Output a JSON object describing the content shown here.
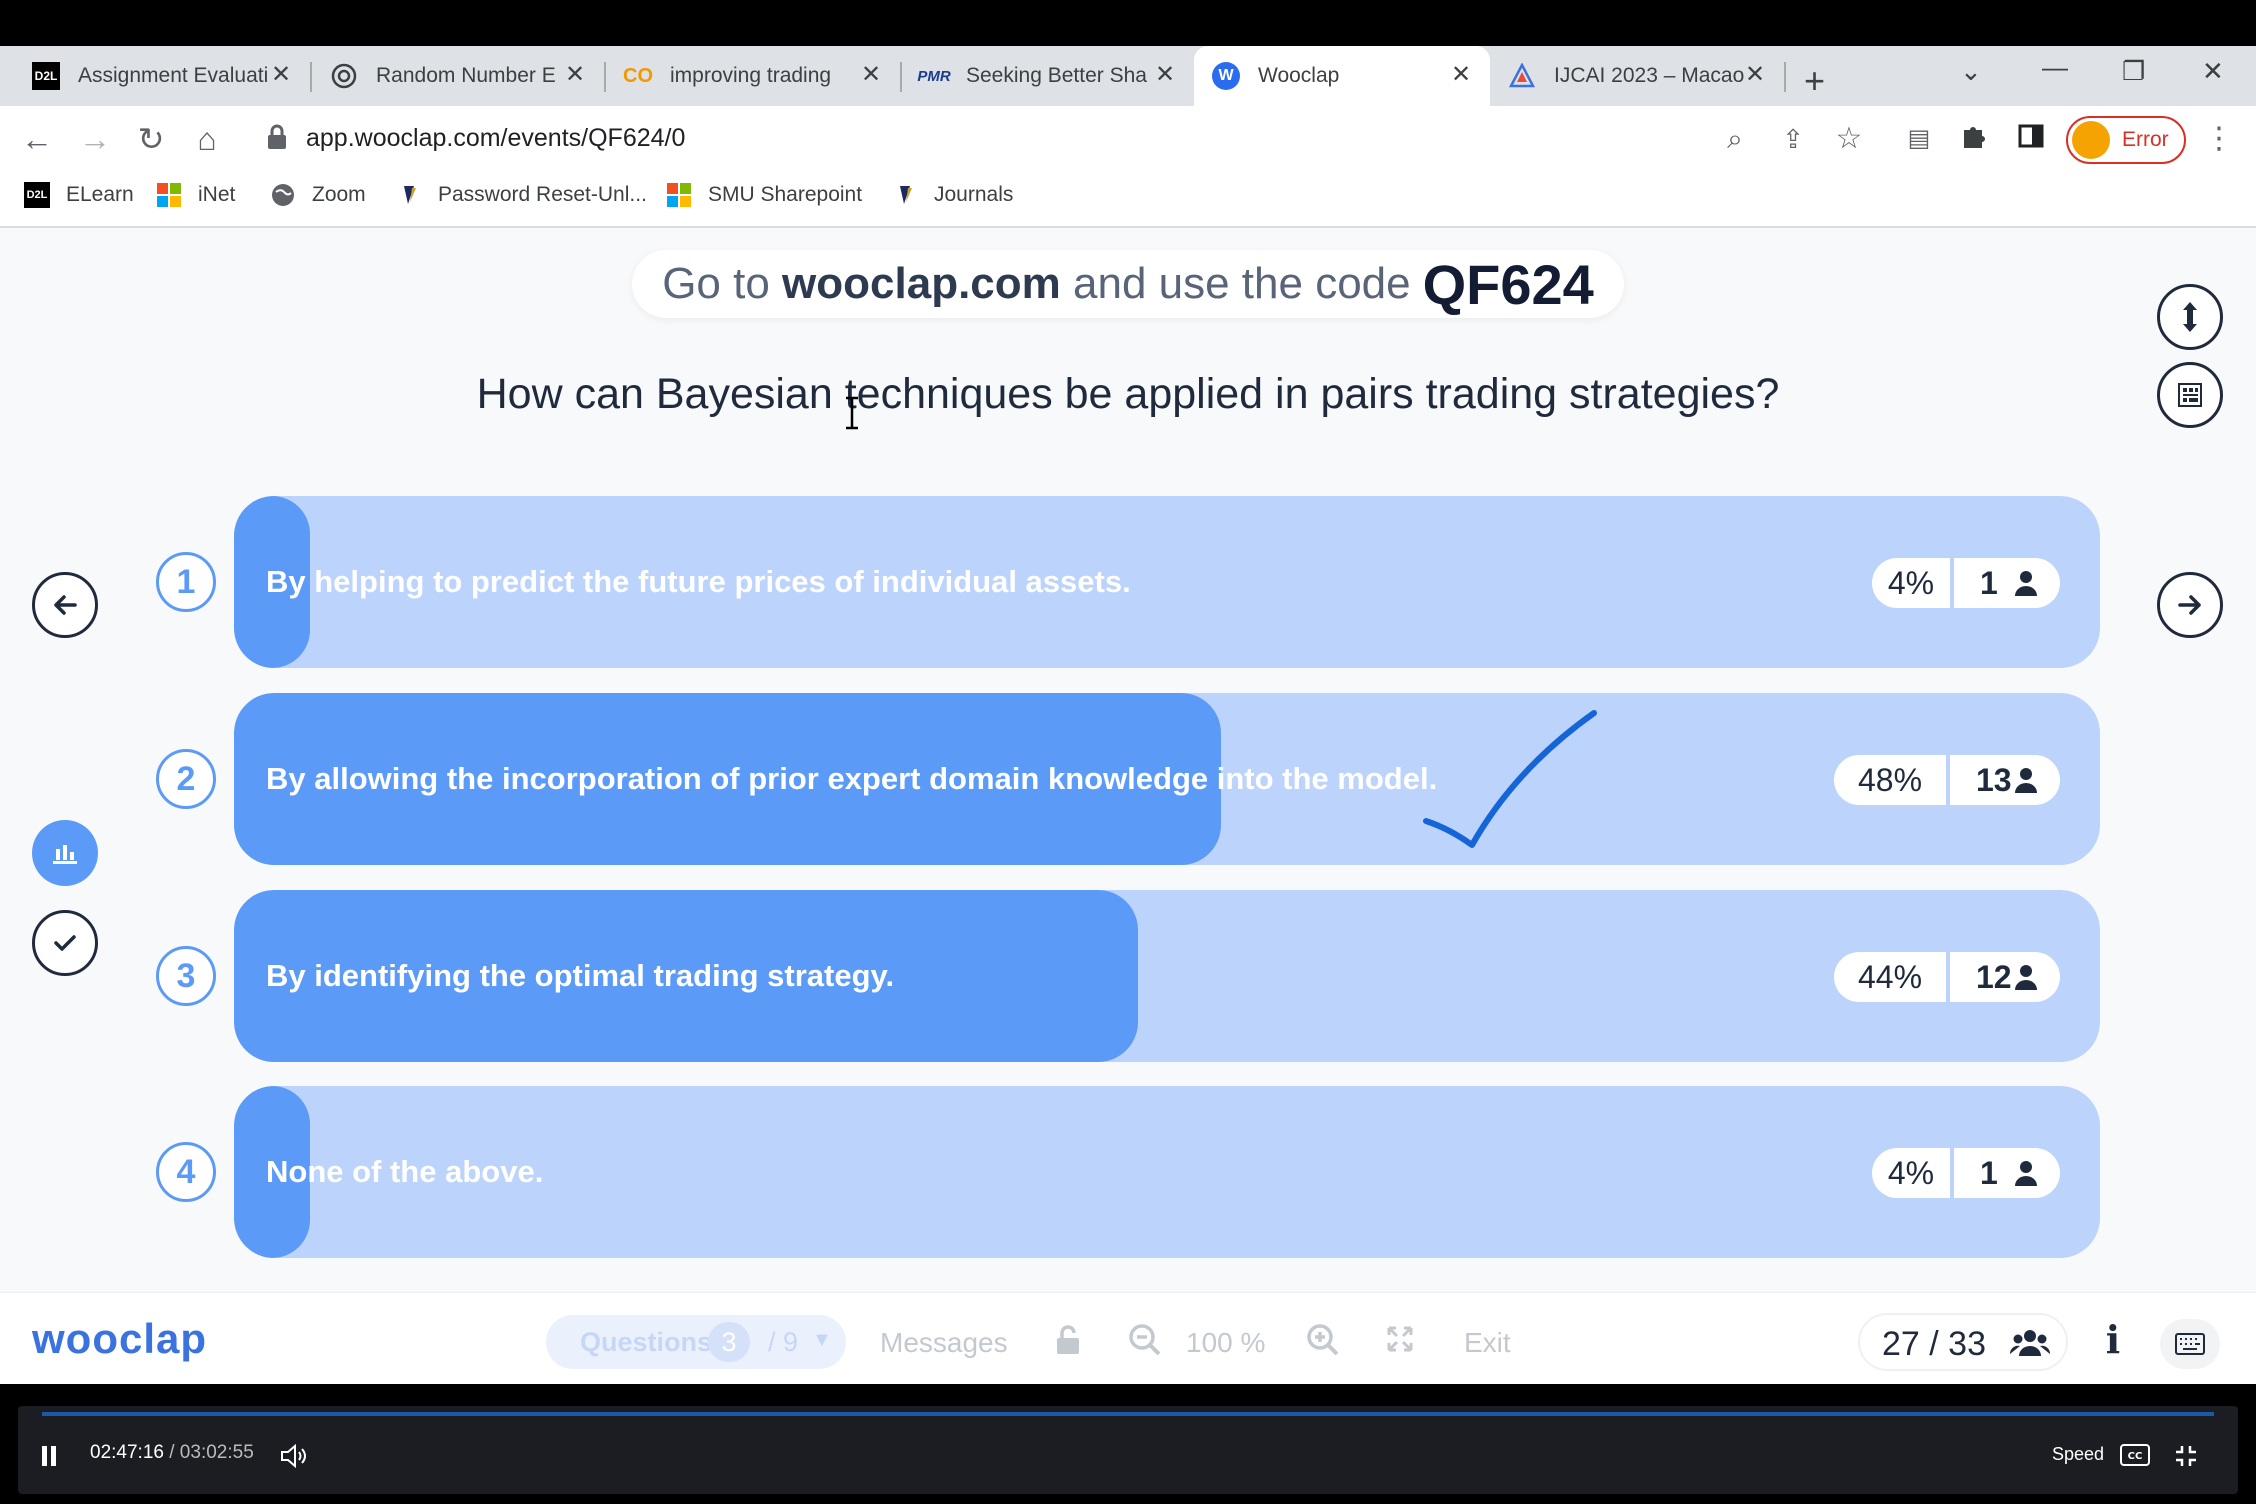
{
  "browser": {
    "tabs": [
      {
        "title": "Assignment Evaluati",
        "favicon": "D2L",
        "active": false
      },
      {
        "title": "Random Number E",
        "favicon": "openai-icon",
        "active": false
      },
      {
        "title": "improving trading",
        "favicon": "CO",
        "active": false
      },
      {
        "title": "Seeking Better Sha",
        "favicon": "PMR",
        "active": false
      },
      {
        "title": "Wooclap",
        "favicon": "W",
        "active": true
      },
      {
        "title": "IJCAI 2023 – Macao",
        "favicon": "ijcai-icon",
        "active": false
      }
    ],
    "url": "app.wooclap.com/events/QF624/0",
    "profile_label": "Error",
    "bookmarks": [
      {
        "label": "ELearn",
        "icon": "D2L"
      },
      {
        "label": "iNet",
        "icon": "windows-icon"
      },
      {
        "label": "Zoom",
        "icon": "globe-icon"
      },
      {
        "label": "Password Reset-Unl...",
        "icon": "smu-icon"
      },
      {
        "label": "SMU Sharepoint",
        "icon": "windows-icon"
      },
      {
        "label": "Journals",
        "icon": "smu-icon"
      }
    ]
  },
  "wooclap": {
    "join": {
      "prefix": "Go to",
      "site": "wooclap.com",
      "middle": "and use the code",
      "code": "QF624"
    },
    "question": "How can Bayesian techniques be applied in pairs trading strategies?",
    "answers": [
      {
        "number": "1",
        "text": "By helping to predict the future prices of individual assets.",
        "percent_label": "4%",
        "percent": 4,
        "count": "1"
      },
      {
        "number": "2",
        "text": "By allowing the incorporation of prior expert domain knowledge into the model.",
        "percent_label": "48%",
        "percent": 48,
        "count": "13"
      },
      {
        "number": "3",
        "text": "By identifying the optimal trading strategy.",
        "percent_label": "44%",
        "percent": 44,
        "count": "12"
      },
      {
        "number": "4",
        "text": "None of the above.",
        "percent_label": "4%",
        "percent": 4,
        "count": "1"
      }
    ],
    "footer": {
      "logo": "wooclap",
      "questions_label": "Questions",
      "questions_current": "3",
      "questions_total": "/ 9",
      "messages_label": "Messages",
      "zoom": "100 %",
      "exit_label": "Exit",
      "participants": "27 / 33"
    }
  },
  "video": {
    "current_time": "02:47:16",
    "total_time": "/ 03:02:55",
    "speed_label": "Speed"
  },
  "colors": {
    "accent": "#5b9bf7",
    "bar_bg": "#bcd3fb",
    "brand": "#3a73e0"
  }
}
